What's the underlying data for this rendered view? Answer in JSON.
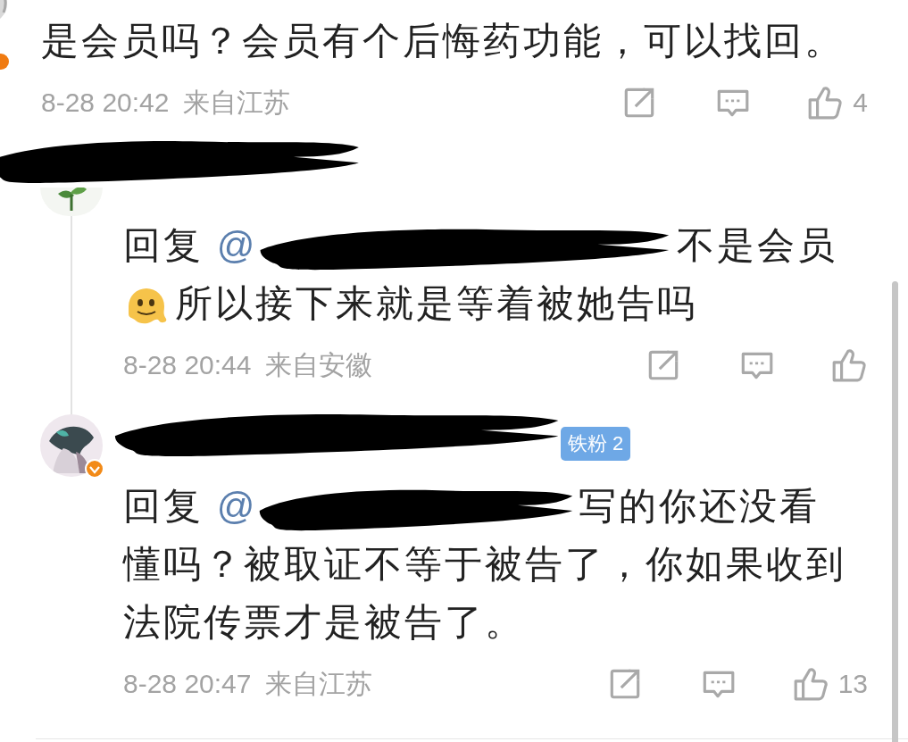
{
  "comment": {
    "text": "是会员吗？会员有个后悔药功能，可以找回。",
    "time": "8-28 20:42",
    "location": "来自江苏",
    "likes": "4"
  },
  "replies": [
    {
      "avatar": {
        "kind": "plant"
      },
      "segments": [
        {
          "kind": "text",
          "text": "回复"
        },
        {
          "kind": "mention",
          "text": "@"
        },
        {
          "kind": "redaction"
        },
        {
          "kind": "text",
          "text": "不是会员"
        },
        {
          "kind": "break"
        },
        {
          "kind": "emoji"
        },
        {
          "kind": "text",
          "text": "所以接下来就是等着被她告吗"
        }
      ],
      "time": "8-28 20:44",
      "location": "来自安徽"
    },
    {
      "avatar": {
        "kind": "drawing",
        "verified": true
      },
      "badge": "铁粉 2",
      "segments": [
        {
          "kind": "text",
          "text": "回复"
        },
        {
          "kind": "mention",
          "text": "@"
        },
        {
          "kind": "redaction"
        },
        {
          "kind": "text",
          "text": "写的你还没看"
        },
        {
          "kind": "paragraph",
          "text": "懂吗？被取证不等于被告了，你如果收到法院传票才是被告了。"
        }
      ],
      "time": "8-28 20:47",
      "location": "来自江苏",
      "likes": "13"
    }
  ]
}
